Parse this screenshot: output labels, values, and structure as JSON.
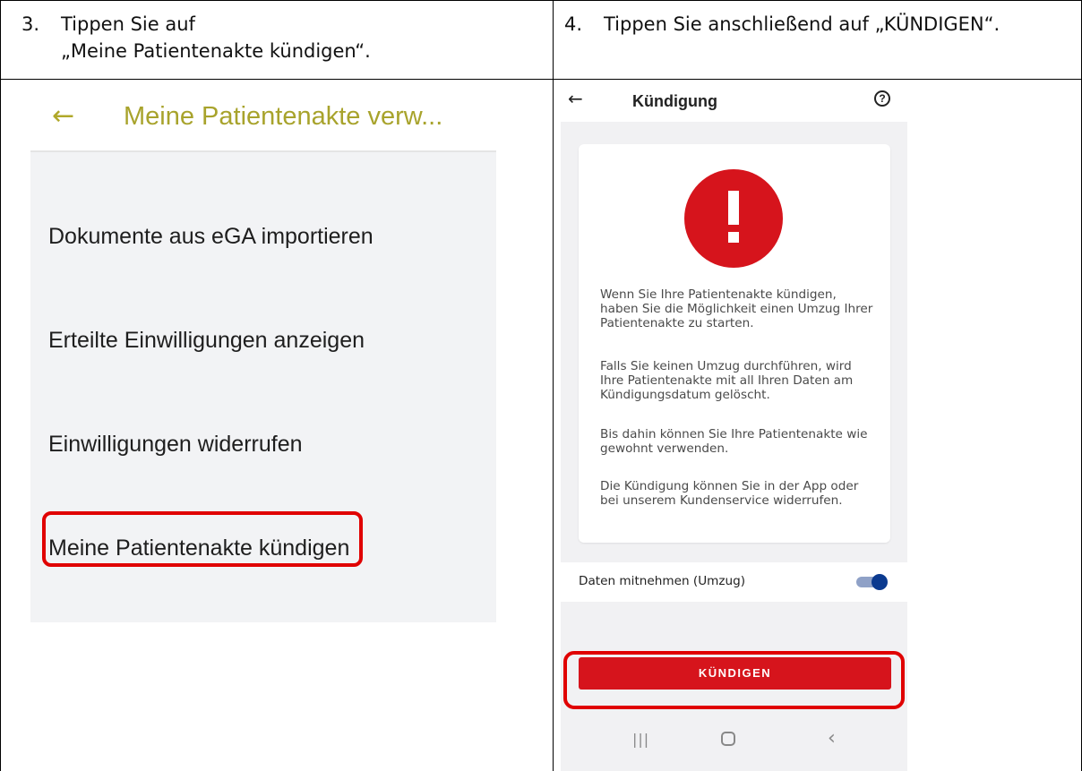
{
  "step3": {
    "number": "3.",
    "line1": "Tippen Sie auf",
    "line2": "„Meine Patientenakte kündigen“."
  },
  "step4": {
    "number": "4.",
    "text": "Tippen Sie anschließend auf „KÜNDIGEN“."
  },
  "left_screen": {
    "back_icon": "arrow-left-icon",
    "title": "Meine Patientenakte verw...",
    "menu_items": [
      "Dokumente aus eGA importieren",
      "Erteilte Einwilligungen anzeigen",
      "Einwilligungen widerrufen",
      "Meine Patientenakte kündigen"
    ],
    "accent_color": "#a8a32c"
  },
  "right_screen": {
    "back_icon": "arrow-left-icon",
    "title": "Kündigung",
    "help_icon": "help-circle-icon",
    "help_glyph": "?",
    "alert_icon": "exclamation-alert-icon",
    "paragraphs": [
      "Wenn Sie Ihre Patientenakte kündigen, haben Sie die Möglichkeit einen Umzug Ihrer Patientenakte zu starten.",
      "Falls Sie keinen Umzug durchführen, wird Ihre Patientenakte mit all Ihren Daten am Kündigungsdatum gelöscht.",
      "Bis dahin können Sie Ihre Patientenakte wie gewohnt verwenden.",
      "Die Kündigung können Sie in der App oder bei unserem Kundenservice widerrufen."
    ],
    "toggle_label": "Daten mitnehmen (Umzug)",
    "toggle_on": true,
    "cancel_button": "KÜNDIGEN",
    "nav": {
      "recent_glyph": "|||",
      "back_glyph": "‹"
    },
    "brand_red": "#d6141c",
    "toggle_color": "#0b3a8f"
  },
  "highlight_color": "#e00000"
}
